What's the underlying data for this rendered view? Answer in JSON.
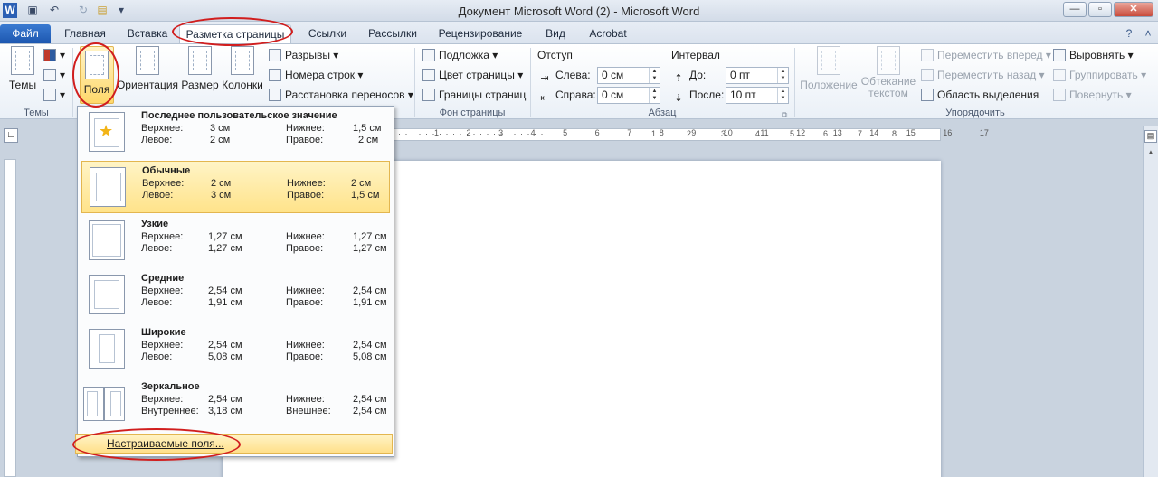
{
  "window": {
    "title": "Документ Microsoft Word (2) - Microsoft Word",
    "minimize": "—",
    "maximize": "▫",
    "close": "✕"
  },
  "quick_access": {
    "app_icon": "W",
    "save": "▣",
    "undo": "↶",
    "redo": "↻",
    "more": "▾"
  },
  "tabs": [
    "Файл",
    "Главная",
    "Вставка",
    "Разметка страницы",
    "Ссылки",
    "Рассылки",
    "Рецензирование",
    "Вид",
    "Acrobat"
  ],
  "ribbon": {
    "themes": {
      "label": "Темы",
      "group": "Темы"
    },
    "page_setup": {
      "fields": "Поля",
      "orientation": "Ориентация",
      "size": "Размер",
      "columns": "Колонки",
      "breaks": "Разрывы",
      "line_numbers": "Номера строк",
      "hyphenation": "Расстановка переносов"
    },
    "page_background": {
      "watermark": "Подложка",
      "page_color": "Цвет страницы",
      "page_borders": "Границы страниц",
      "group": "Фон страницы"
    },
    "paragraph": {
      "indent": "Отступ",
      "left_label": "Слева:",
      "left_value": "0 см",
      "right_label": "Справа:",
      "right_value": "0 см",
      "spacing": "Интервал",
      "before_label": "До:",
      "before_value": "0 пт",
      "after_label": "После:",
      "after_value": "10 пт",
      "group": "Абзац"
    },
    "arrange": {
      "position": "Положение",
      "wrap_line1": "Обтекание",
      "wrap_line2": "текстом",
      "bring_forward": "Переместить вперед",
      "send_backward": "Переместить назад",
      "selection_pane": "Область выделения",
      "align": "Выровнять",
      "group_btn": "Группировать",
      "rotate": "Повернуть",
      "group": "Упорядочить"
    }
  },
  "ruler_ticks": [
    "1",
    "2",
    "3",
    "4",
    "5",
    "6",
    "7",
    "8",
    "9",
    "10",
    "11",
    "12",
    "13",
    "14",
    "15",
    "16",
    "17"
  ],
  "margins_menu": {
    "options": [
      {
        "title": "Последнее пользовательское значение",
        "top_label": "Верхнее:",
        "top": "3 см",
        "bottom_label": "Нижнее:",
        "bottom": "1,5 см",
        "left_label": "Левое:",
        "left": "2 см",
        "right_label": "Правое:",
        "right": "2 см"
      },
      {
        "title": "Обычные",
        "top_label": "Верхнее:",
        "top": "2 см",
        "bottom_label": "Нижнее:",
        "bottom": "2 см",
        "left_label": "Левое:",
        "left": "3 см",
        "right_label": "Правое:",
        "right": "1,5 см"
      },
      {
        "title": "Узкие",
        "top_label": "Верхнее:",
        "top": "1,27 см",
        "bottom_label": "Нижнее:",
        "bottom": "1,27 см",
        "left_label": "Левое:",
        "left": "1,27 см",
        "right_label": "Правое:",
        "right": "1,27 см"
      },
      {
        "title": "Средние",
        "top_label": "Верхнее:",
        "top": "2,54 см",
        "bottom_label": "Нижнее:",
        "bottom": "2,54 см",
        "left_label": "Левое:",
        "left": "1,91 см",
        "right_label": "Правое:",
        "right": "1,91 см"
      },
      {
        "title": "Широкие",
        "top_label": "Верхнее:",
        "top": "2,54 см",
        "bottom_label": "Нижнее:",
        "bottom": "2,54 см",
        "left_label": "Левое:",
        "left": "5,08 см",
        "right_label": "Правое:",
        "right": "5,08 см"
      },
      {
        "title": "Зеркальное",
        "top_label": "Верхнее:",
        "top": "2,54 см",
        "bottom_label": "Нижнее:",
        "bottom": "2,54 см",
        "left_label": "Внутреннее:",
        "left": "3,18 см",
        "right_label": "Внешнее:",
        "right": "2,54 см"
      }
    ],
    "custom_margins": "Настраиваемые поля..."
  },
  "colors": {
    "accent": "#1d57b0",
    "highlight": "#ffe38a",
    "annotation": "#d11e1e"
  }
}
